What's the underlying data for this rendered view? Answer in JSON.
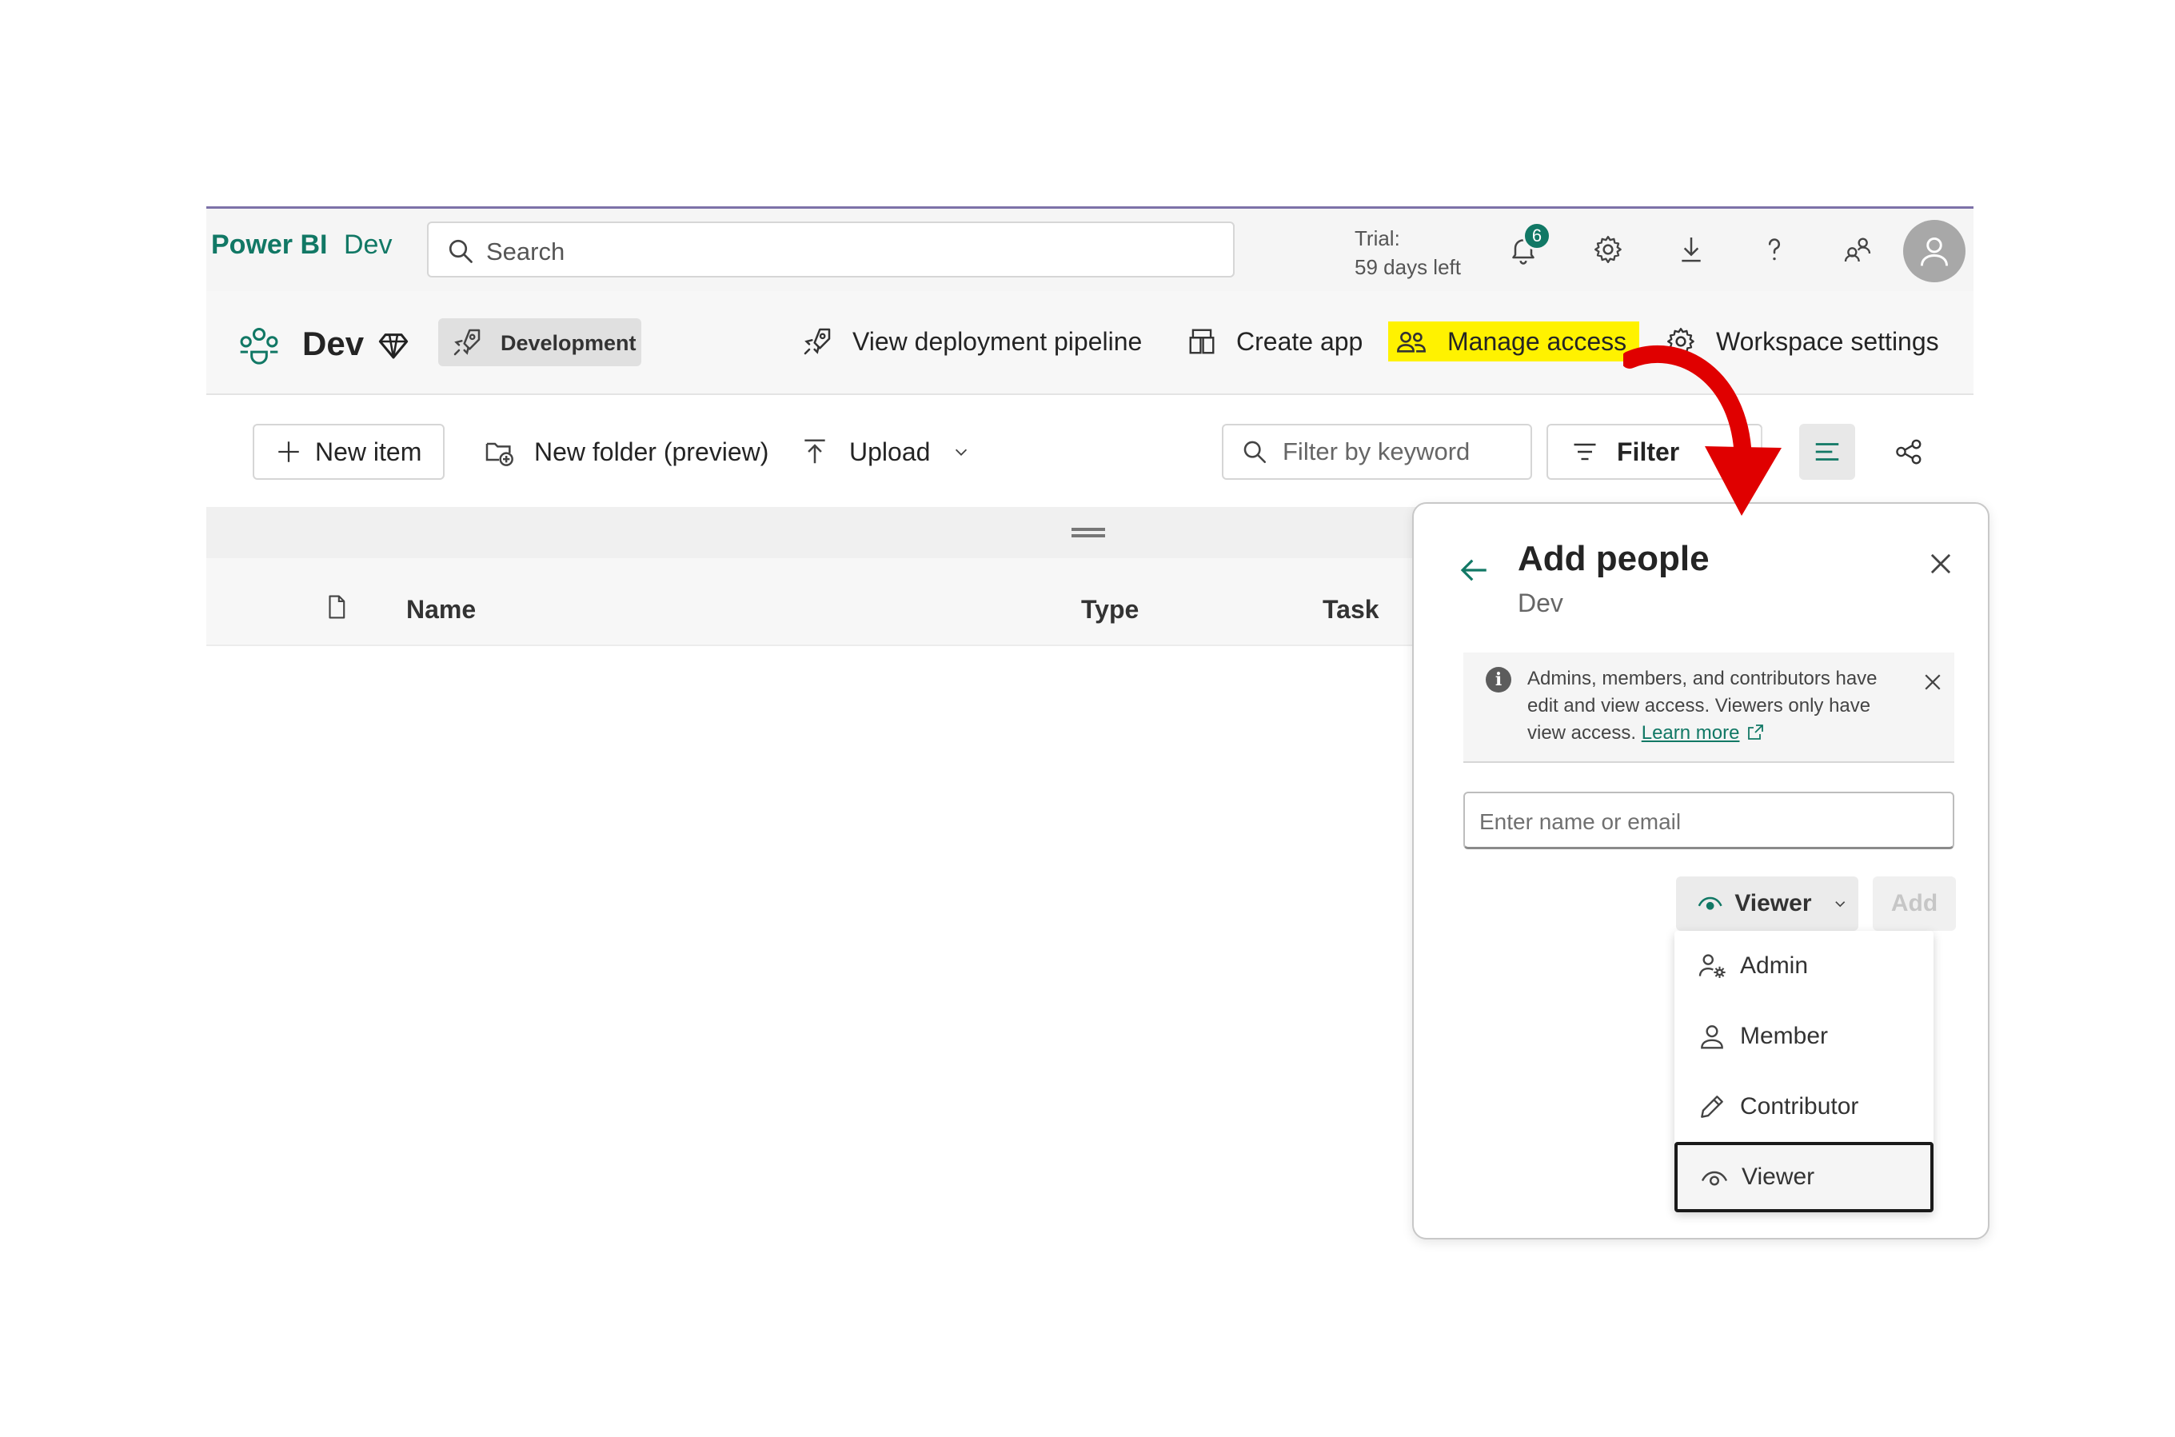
{
  "topbar": {
    "brand": "Power BI",
    "workspace": "Dev",
    "search_placeholder": "Search",
    "trial_line1": "Trial:",
    "trial_line2": "59 days left",
    "notification_count": "6",
    "icons": [
      "bell-icon",
      "gear-icon",
      "download-icon",
      "help-icon",
      "share-icon",
      "avatar-icon"
    ]
  },
  "workspace_header": {
    "title": "Dev",
    "stage": "Development",
    "actions": {
      "pipeline": "View deployment pipeline",
      "create_app": "Create app",
      "manage_access": "Manage access",
      "settings": "Workspace settings"
    },
    "highlight_color": "#fff200"
  },
  "toolbar": {
    "new_item": "New item",
    "new_folder": "New folder (preview)",
    "upload": "Upload",
    "filter_placeholder": "Filter by keyword",
    "filter": "Filter"
  },
  "table": {
    "columns": [
      "Name",
      "Type",
      "Task"
    ]
  },
  "add_people": {
    "title": "Add people",
    "subtitle": "Dev",
    "info_text": "Admins, members, and contributors have edit and view access. Viewers only have view access.",
    "learn_more": "Learn more",
    "input_placeholder": "Enter name or email",
    "selected_role": "Viewer",
    "add_label": "Add",
    "roles": [
      {
        "label": "Admin",
        "icon": "admin-icon"
      },
      {
        "label": "Member",
        "icon": "member-icon"
      },
      {
        "label": "Contributor",
        "icon": "pencil-icon"
      },
      {
        "label": "Viewer",
        "icon": "eye-icon"
      }
    ]
  },
  "colors": {
    "brand": "#117865",
    "annotation_arrow": "#e00000"
  }
}
